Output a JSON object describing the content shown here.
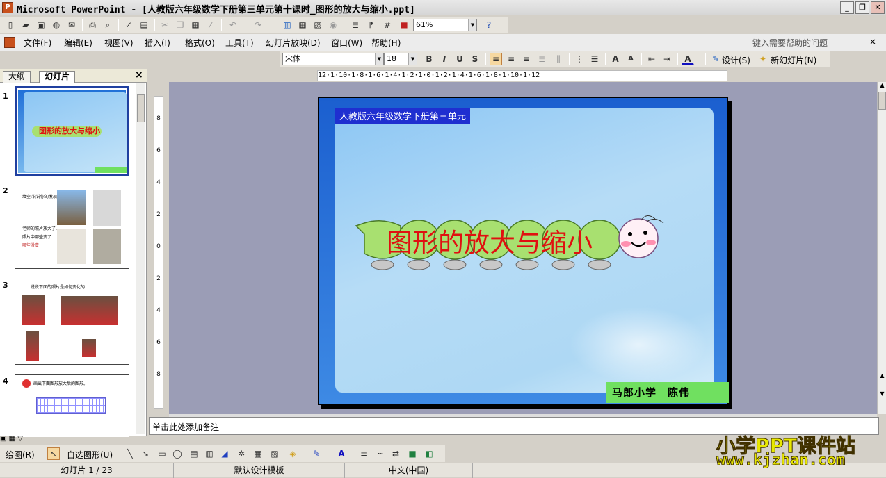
{
  "window": {
    "title": "Microsoft PowerPoint - [人教版六年级数学下册第三单元第十课时_图形的放大与缩小.ppt]",
    "app_icon": "powerpoint-icon",
    "minimize": "_",
    "restore": "❐",
    "close": "✕"
  },
  "standard_toolbar": {
    "zoom": "61%",
    "icons": [
      "new-icon",
      "open-icon",
      "save-icon",
      "permission-icon",
      "email-icon",
      "print-icon",
      "preview-icon",
      "spelling-icon",
      "research-icon",
      "cut-icon",
      "copy-icon",
      "paste-icon",
      "format-painter-icon",
      "undo-icon",
      "redo-icon",
      "chart-icon",
      "table-icon",
      "tables-borders-icon",
      "hyperlink-icon",
      "expand-icon",
      "show-formatting-icon",
      "grid-icon",
      "color-icon",
      "help-icon"
    ]
  },
  "menu": {
    "items": [
      "文件(F)",
      "编辑(E)",
      "视图(V)",
      "插入(I)",
      "格式(O)",
      "工具(T)",
      "幻灯片放映(D)",
      "窗口(W)",
      "帮助(H)"
    ],
    "help_placeholder": "键入需要帮助的问题",
    "close_doc": "×"
  },
  "formatting_toolbar": {
    "font": "宋体",
    "font_size": "18",
    "bold": "B",
    "italic": "I",
    "underline": "U",
    "shadow": "S",
    "font_color_label": "A",
    "design_label": "设计(S)",
    "new_slide_label": "新幻灯片(N)"
  },
  "ruler": {
    "horizontal": "12·1·10·1·8·1·6·1·4·1·2·1·0·1·2·1·4·1·6·1·8·1·10·1·12",
    "vertical": [
      "8",
      "6",
      "4",
      "2",
      "0",
      "2",
      "4",
      "6",
      "8"
    ]
  },
  "panel": {
    "tabs": [
      "大纲",
      "幻灯片"
    ],
    "close": "×",
    "slides": [
      {
        "num": "1",
        "title": "图形的放大与缩小"
      },
      {
        "num": "2",
        "lines": [
          "填空:说说你的发现",
          "老师的照片放大了,",
          "照片中哪些变了",
          "哪些没变"
        ]
      },
      {
        "num": "3",
        "caption": "说说下面的照片是如何变化的"
      },
      {
        "num": "4",
        "caption": "画出下面图形放大后的图形。"
      }
    ]
  },
  "slide": {
    "banner": "人教版六年级数学下册第三单元",
    "title": "图形的放大与缩小",
    "author": "马郎小学　陈伟"
  },
  "notes": {
    "placeholder": "单击此处添加备注"
  },
  "drawing_toolbar": {
    "draw_label": "绘图(R)",
    "autoshapes_label": "自选图形(U)"
  },
  "status_bar": {
    "slide_info": "幻灯片 1 / 23",
    "template": "默认设计模板",
    "language": "中文(中国)"
  },
  "watermark": {
    "line1": "小学PPT课件站",
    "line2": "www.kjzhan.com"
  }
}
